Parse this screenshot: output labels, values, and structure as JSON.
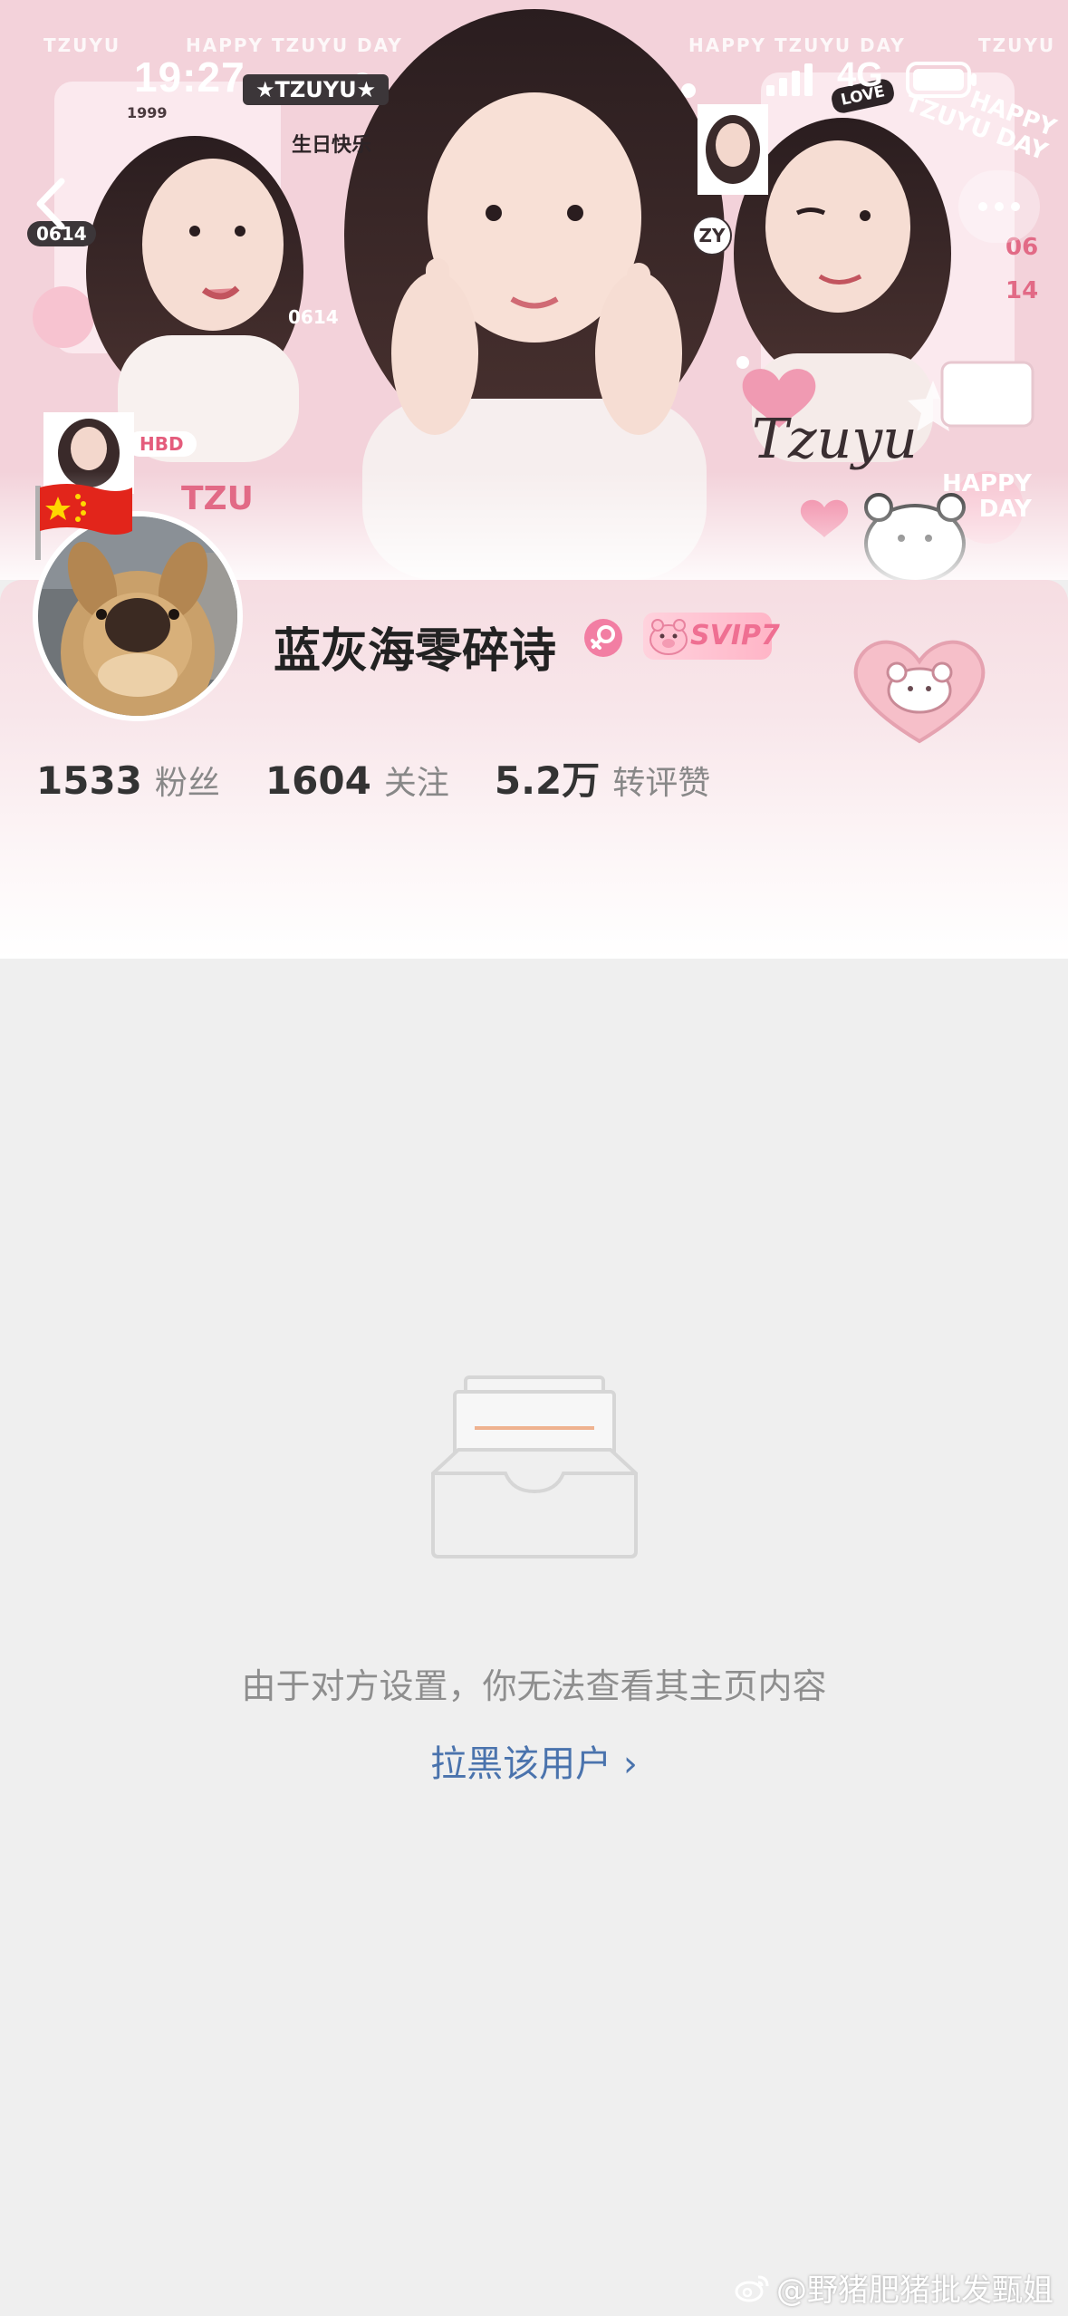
{
  "status_bar": {
    "time": "19:27",
    "network": "4G"
  },
  "cover": {
    "corner_label_left": "TZUYU",
    "corner_label_right": "TZUYU",
    "banner_left": "HAPPY TZUYU DAY",
    "banner_right": "HAPPY TZUYU DAY",
    "name_tag": "★TZUYU★",
    "year": "1999",
    "birthday_text": "生日快乐",
    "date_badge": "0614",
    "date_text": "0614",
    "hbd_badge": "HBD",
    "itzu_text": "TZU",
    "zy_badge": "ZY",
    "love_badge": "LOVE",
    "signature": "Tzuyu",
    "happy_day": "HAPPY\nDAY",
    "happy_day_top": "HAPPY\nTZUYU DAY",
    "date_num_1": "06",
    "date_num_2": "14"
  },
  "profile": {
    "username": "蓝灰海零碎诗",
    "vip_badge": "SVIP7",
    "stats": [
      {
        "value": "1533",
        "label": "粉丝"
      },
      {
        "value": "1604",
        "label": "关注"
      },
      {
        "value": "5.2万",
        "label": "转评赞"
      }
    ]
  },
  "empty_state": {
    "message": "由于对方设置，你无法查看其主页内容",
    "action_label": "拉黑该用户 ›"
  },
  "watermark": "@野猪肥猪批发甄姐",
  "colors": {
    "link": "#4a73ad",
    "background": "#efefef",
    "accent_pink": "#f27ea3"
  }
}
